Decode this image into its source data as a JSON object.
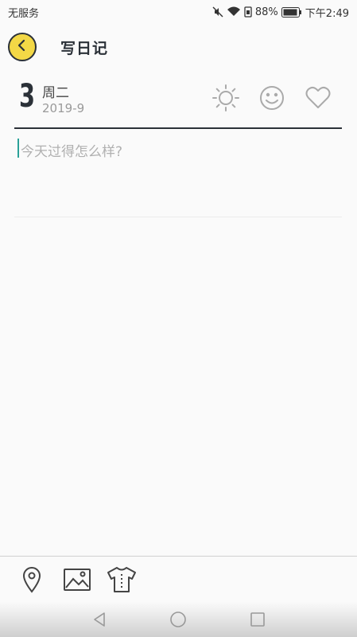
{
  "status_bar": {
    "carrier": "无服务",
    "battery_percent": "88%",
    "time": "下午2:49",
    "icons": [
      "mute-icon",
      "wifi-icon",
      "sim-icon",
      "battery-icon"
    ]
  },
  "header": {
    "title": "写日记",
    "back_icon": "chevron-left-icon"
  },
  "date": {
    "day": "3",
    "weekday": "周二",
    "year_month": "2019-9"
  },
  "mood": {
    "icons": [
      "sun-icon",
      "smile-icon",
      "heart-icon"
    ]
  },
  "editor": {
    "placeholder": "今天过得怎么样?",
    "value": ""
  },
  "toolbar": {
    "icons": [
      "location-pin-icon",
      "image-icon",
      "shirt-icon"
    ]
  },
  "nav": {
    "icons": [
      "nav-back-icon",
      "nav-home-icon",
      "nav-recent-icon"
    ]
  },
  "colors": {
    "accent_yellow": "#f3d846",
    "dark": "#2b3138",
    "caret": "#2aa198"
  }
}
